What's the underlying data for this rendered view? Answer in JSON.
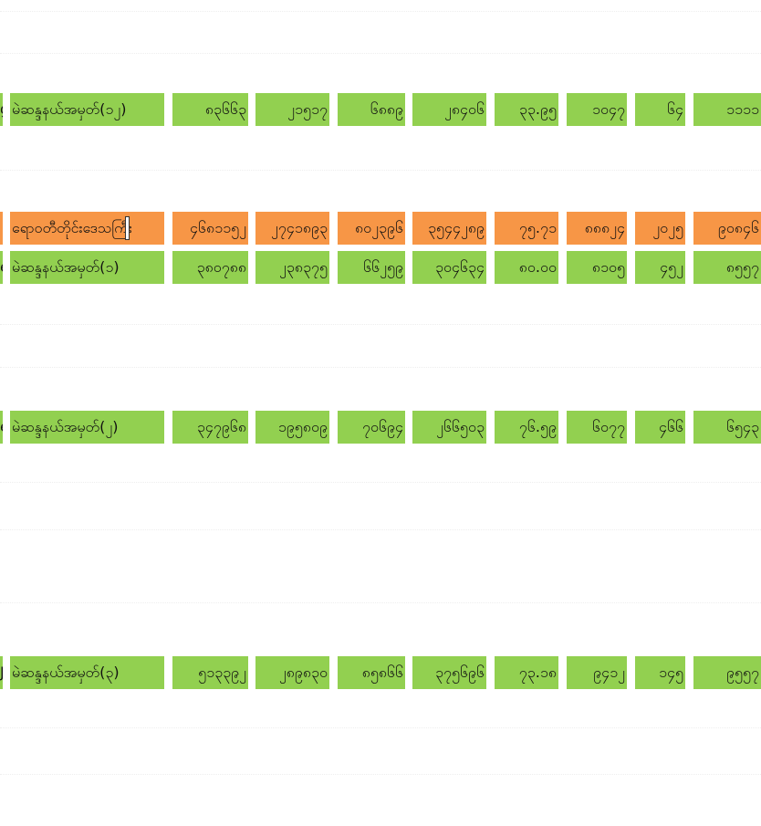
{
  "colors": {
    "green_row": "#92d050",
    "orange_row": "#f79646",
    "background": "#ffffff"
  },
  "rows": [
    {
      "style": "green",
      "stub": "g",
      "label": "မဲဆန္ဒနယ်အမှတ်(၁၂)",
      "values": [
        "၈၃၆၆၃",
        "၂၁၅၁၇",
        "၆၈၈၉",
        "၂၈၄၀၆",
        "၃၃.၉၅",
        "၁၀၄၇",
        "၆၄",
        "၁၁၁၁"
      ]
    },
    {
      "style": "orange",
      "stub": "",
      "label": "ရောဝတီတိုင်းဒေသကြီး",
      "values": [
        "၄၆၈၁၁၅၂",
        "၂၇၄၁၈၉၃",
        "၈၀၂၃၉၆",
        "၃၅၄၄၂၈၉",
        "၇၅.၇၁",
        "၈၈၈၂၄",
        "၂၀၂၅",
        "၉၀၈၄၆"
      ]
    },
    {
      "style": "green",
      "stub": "e",
      "label": "မဲဆန္ဒနယ်အမှတ်(၁)",
      "values": [
        "၃၈၀၇၈၈",
        "၂၃၈၃၇၅",
        "၆၆၂၅၉",
        "၃၀၄၆၃၄",
        "၈၀.၀၀",
        "၈၁၀၅",
        "၄၅၂",
        "၈၅၅၇"
      ]
    },
    {
      "style": "green",
      "stub": "e",
      "label": "မဲဆန္ဒနယ်အမှတ်(၂)",
      "values": [
        "၃၄၇၉၆၈",
        "၁၉၅၈၀၉",
        "၇၀၆၉၄",
        "၂၆၆၅၀၃",
        "၇၆.၅၉",
        "၆၀၇၇",
        "၄၆၆",
        "၆၅၄၃"
      ]
    },
    {
      "style": "green",
      "stub": "J",
      "label": "မဲဆန္ဒနယ်အမှတ်(၃)",
      "values": [
        "၅၁၃၃၉၂",
        "၂၈၉၈၃၀",
        "၈၅၈၆၆",
        "၃၇၅၆၉၆",
        "၇၃.၁၈",
        "၉၄၁၂",
        "၁၄၅",
        "၉၅၅၇"
      ]
    }
  ]
}
